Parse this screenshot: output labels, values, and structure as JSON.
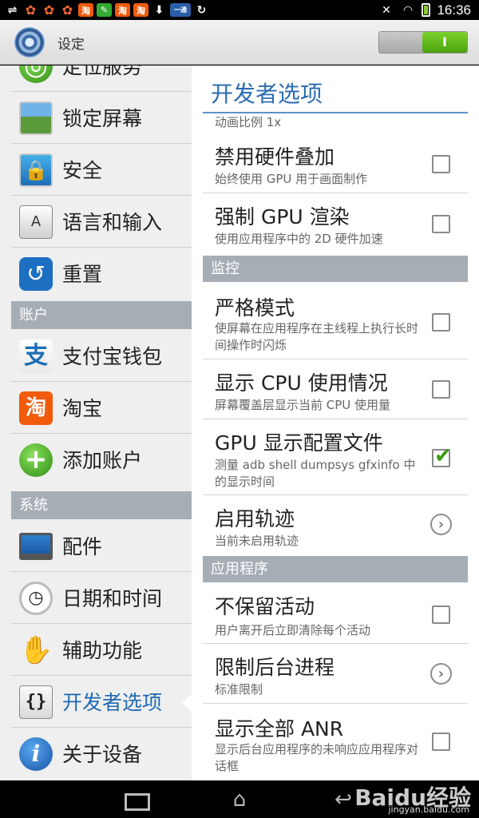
{
  "status_bar": {
    "time": "16:36",
    "left_icons": [
      "usb-icon",
      "clover-icon",
      "clover-icon",
      "clover-icon",
      "taobao-icon",
      "cleaner-icon",
      "taobao-icon",
      "taobao-icon",
      "download-icon",
      "box-icon",
      "sync-icon"
    ],
    "right_icons": [
      "mute-icon",
      "wifi-icon",
      "battery-icon"
    ],
    "box_text": "一通"
  },
  "action_bar": {
    "title": "设定",
    "toggle_label": "I"
  },
  "left_menu": {
    "items": [
      {
        "label": "定位服务",
        "icon": "location-icon"
      },
      {
        "label": "锁定屏幕",
        "icon": "lock-screen-icon"
      },
      {
        "label": "安全",
        "icon": "security-icon"
      },
      {
        "label": "语言和输入",
        "icon": "keyboard-icon"
      },
      {
        "label": "重置",
        "icon": "reset-icon"
      },
      {
        "label": "支付宝钱包",
        "icon": "alipay-icon"
      },
      {
        "label": "淘宝",
        "icon": "taobao-icon"
      },
      {
        "label": "添加账户",
        "icon": "add-icon"
      },
      {
        "label": "配件",
        "icon": "accessory-icon"
      },
      {
        "label": "日期和时间",
        "icon": "clock-icon"
      },
      {
        "label": "辅助功能",
        "icon": "hand-icon"
      },
      {
        "label": "开发者选项",
        "icon": "developer-icon"
      },
      {
        "label": "关于设备",
        "icon": "info-icon"
      }
    ],
    "headers": {
      "accounts": "账户",
      "system": "系统"
    },
    "selected": "开发者选项"
  },
  "developer": {
    "title": "开发者选项",
    "partial_subtitle": "动画比例 1x",
    "items": [
      {
        "title": "禁用硬件叠加",
        "subtitle": "始终使用 GPU 用于画面制作",
        "control": "checkbox",
        "checked": false
      },
      {
        "title": "强制 GPU 渲染",
        "subtitle": "使用应用程序中的 2D 硬件加速",
        "control": "checkbox",
        "checked": false
      },
      {
        "title": "严格模式",
        "subtitle": "使屏幕在应用程序在主线程上执行长时间操作时闪烁",
        "control": "checkbox",
        "checked": false
      },
      {
        "title": "显示 CPU 使用情况",
        "subtitle": "屏幕覆盖层显示当前 CPU 使用量",
        "control": "checkbox",
        "checked": false
      },
      {
        "title": "GPU 显示配置文件",
        "subtitle": "测量 adb shell dumpsys gfxinfo 中的显示时间",
        "control": "checkbox",
        "checked": true
      },
      {
        "title": "启用轨迹",
        "subtitle": "当前未启用轨迹",
        "control": "chevron"
      },
      {
        "title": "不保留活动",
        "subtitle": "用户离开后立即清除每个活动",
        "control": "checkbox",
        "checked": false
      },
      {
        "title": "限制后台进程",
        "subtitle": "标准限制",
        "control": "chevron"
      },
      {
        "title": "显示全部 ANR",
        "subtitle": "显示后台应用程序的未响应应用程序对话框",
        "control": "checkbox",
        "checked": false
      }
    ],
    "headers": {
      "monitoring": "监控",
      "apps": "应用程序"
    }
  },
  "nav_bar": {
    "watermark": "Baidu经验",
    "watermark_url": "jingyan.baidu.com"
  },
  "colors": {
    "accent": "#2b6cb0",
    "toggle_on": "#5cb71a",
    "header_bg": "#a6adb5",
    "check": "#3d9b12"
  }
}
